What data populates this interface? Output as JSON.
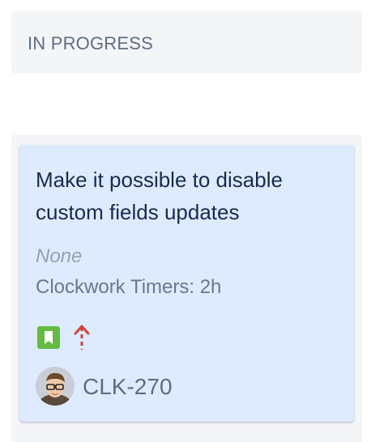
{
  "column": {
    "title": "IN PROGRESS"
  },
  "card": {
    "summary": "Make it possible to disable custom fields updates",
    "field_value": "None",
    "timer": "Clockwork Timers: 2h",
    "issue_type_icon": "bookmark-icon",
    "priority_icon": "priority-highest-arrow-icon",
    "avatar_icon": "user-avatar",
    "issue_key": "CLK-270"
  },
  "colors": {
    "card_bg": "#deebff",
    "story_green": "#65ba43",
    "priority_red": "#d04437"
  }
}
